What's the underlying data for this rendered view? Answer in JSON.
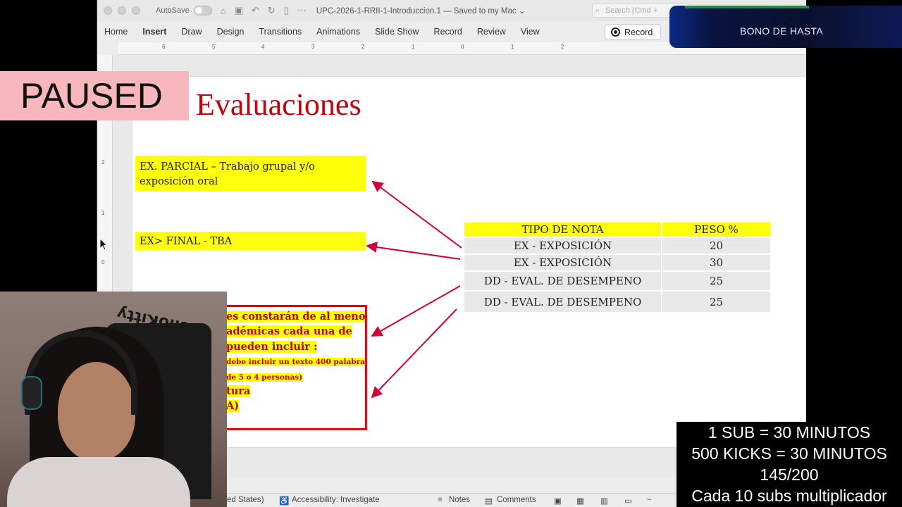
{
  "window": {
    "autosave_label": "AutoSave",
    "doc_title": "UPC-2026-1-RRII-1-Introduccion.1 — Saved to my Mac ⌄",
    "search_placeholder": "Search (Cmd +",
    "ribbon_tabs": [
      "Home",
      "Insert",
      "Draw",
      "Design",
      "Transitions",
      "Animations",
      "Slide Show",
      "Record",
      "Review",
      "View"
    ],
    "active_tab": "Insert",
    "record_button": "Record"
  },
  "ruler": {
    "h_numbers": [
      "6",
      "5",
      "4",
      "3",
      "2",
      "1",
      "0",
      "1",
      "2"
    ],
    "v_numbers": [
      "2",
      "1",
      "0"
    ]
  },
  "slide": {
    "title": "Evaluaciones",
    "box_parcial": "EX. PARCIAL – Trabajo grupal y/o exposición oral",
    "box_final": "EX> FINAL - TBA",
    "red_box_lines": [
      "es constarán de al menos",
      "adémicas cada una de",
      "pueden incluir :",
      "debe incluir un texto 400 palabras)",
      "de 5 o 4 personas)",
      "tura",
      "A)"
    ],
    "table": {
      "headers": [
        "TIPO DE NOTA",
        "PESO %"
      ],
      "rows": [
        [
          "EX - EXPOSICIÓN",
          "20"
        ],
        [
          "EX - EXPOSICIÓN",
          "30"
        ],
        [
          "DD - EVAL. DE DESEMPENO",
          "25"
        ],
        [
          "DD - EVAL. DE DESEMPENO",
          "25"
        ]
      ]
    }
  },
  "statusbar": {
    "language": "ed States)",
    "accessibility": "Accessibility: Investigate",
    "notes": "Notes",
    "comments": "Comments"
  },
  "overlays": {
    "paused": "PAUSED",
    "bono": "BONO DE HASTA",
    "sub_lines": [
      "1 SUB      = 30 MINUTOS",
      "500 KICKS = 30 MINUTOS",
      "145/200",
      "Cada 10 subs multiplicador"
    ],
    "webcam_sign": "HelloKitty"
  },
  "colors": {
    "title_red": "#c0000b",
    "highlight_yellow": "#ffff0a",
    "paused_pink": "#f8b6bd"
  }
}
